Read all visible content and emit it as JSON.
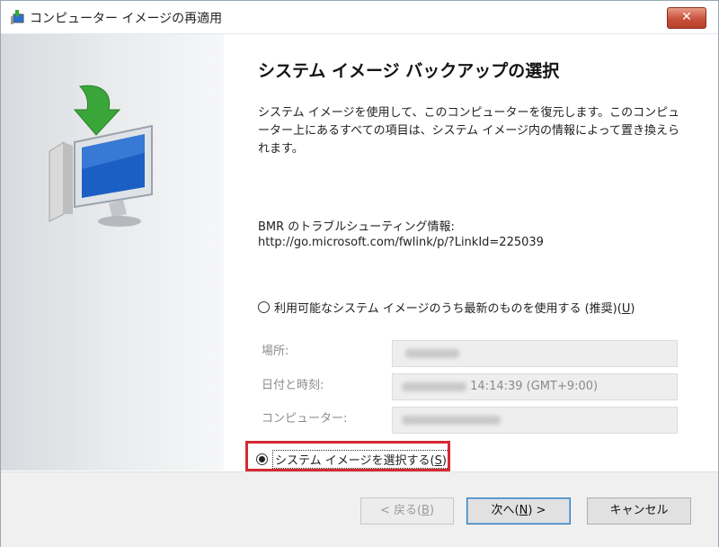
{
  "window": {
    "title": "コンピューター イメージの再適用",
    "close_label": "✕"
  },
  "main": {
    "heading": "システム イメージ バックアップの選択",
    "description": "システム イメージを使用して、このコンピューターを復元します。このコンピューター上にあるすべての項目は、システム イメージ内の情報によって置き換えられます。",
    "bmr_label": "BMR のトラブルシューティング情報:",
    "bmr_url": "http://go.microsoft.com/fwlink/p/?LinkId=225039",
    "option_latest": {
      "label": "利用可能なシステム イメージのうち最新のものを使用する (推奨)(",
      "accel": "U",
      "suffix": ")",
      "selected": false
    },
    "fields": {
      "location_label": "場所:",
      "datetime_label": "日付と時刻:",
      "datetime_value": "14:14:39 (GMT+9:00)",
      "computer_label": "コンピューター:"
    },
    "option_select": {
      "label": "システム イメージを選択する(",
      "accel": "S",
      "suffix": ")",
      "selected": true
    }
  },
  "footer": {
    "back": {
      "label": "< 戻る(",
      "accel": "B",
      "suffix": ")"
    },
    "next": {
      "label": "次へ(",
      "accel": "N",
      "suffix": ") >"
    },
    "cancel": {
      "label": "キャンセル"
    }
  },
  "colors": {
    "highlight": "#d42a33",
    "title_close": "#c9503b",
    "monitor_screen": "#1c5fc4",
    "arrow": "#3aa639"
  },
  "icons": [
    "restore-app-icon",
    "restore-computer-icon",
    "close-icon"
  ]
}
